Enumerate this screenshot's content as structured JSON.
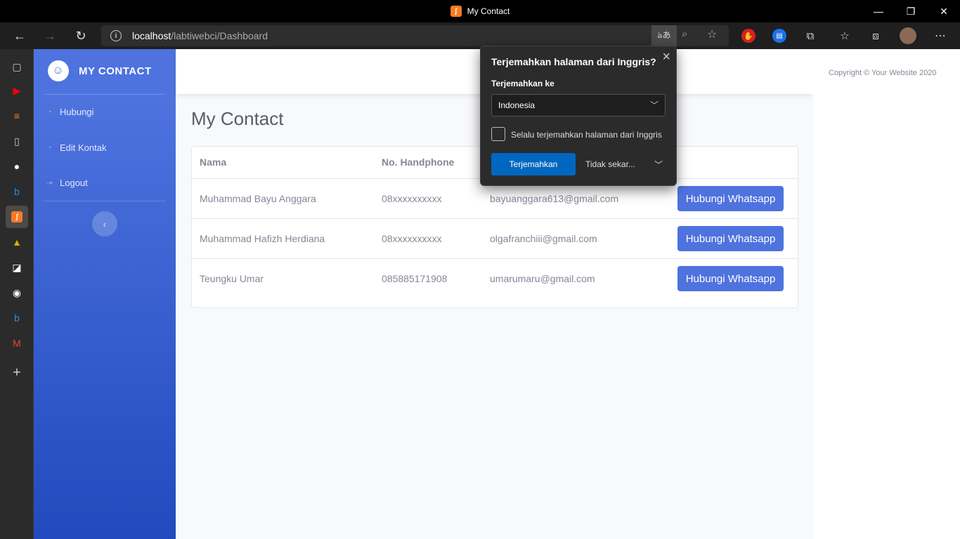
{
  "window": {
    "title": "My Contact",
    "app_icon_glyph": "ʃ",
    "minimize": "—",
    "maximize": "❐",
    "close": "✕"
  },
  "browser": {
    "url_host": "localhost",
    "url_path": "/labtiwebci/Dashboard",
    "translate_glyph": "ঌあ",
    "nav_back": "←",
    "nav_forward": "→",
    "nav_reload": "↻"
  },
  "sidebar": {
    "brand": "MY CONTACT",
    "items": [
      {
        "label": "Hubungi",
        "icon": "dashboard-icon"
      },
      {
        "label": "Edit Kontak",
        "icon": "dashboard-icon"
      },
      {
        "label": "Logout",
        "icon": "sign-out-icon"
      }
    ],
    "toggle_glyph": "‹"
  },
  "main": {
    "heading": "My Contact",
    "table": {
      "headers": [
        "Nama",
        "No. Handphone",
        "",
        ""
      ],
      "rows": [
        {
          "name": "Muhammad Bayu Anggara",
          "phone": "08xxxxxxxxxx",
          "email": "bayuanggara613@gmail.com",
          "action": "Hubungi Whatsapp"
        },
        {
          "name": "Muhammad Hafizh Herdiana",
          "phone": "08xxxxxxxxxx",
          "email": "olgafranchiii@gmail.com",
          "action": "Hubungi Whatsapp"
        },
        {
          "name": "Teungku Umar",
          "phone": "085885171908",
          "email": "umarumaru@gmail.com",
          "action": "Hubungi Whatsapp"
        }
      ]
    },
    "copyright": "Copyright © Your Website 2020"
  },
  "translate_popup": {
    "title": "Terjemahkan halaman dari Inggris?",
    "label": "Terjemahkan ke",
    "selected_language": "Indonesia",
    "checkbox_label": "Selalu terjemahkan halaman dari Inggris",
    "primary": "Terjemahkan",
    "secondary": "Tidak sekar..."
  },
  "colors": {
    "primary": "#4e73df",
    "primary_dark": "#224abe",
    "edge_blue": "#0067c0"
  }
}
